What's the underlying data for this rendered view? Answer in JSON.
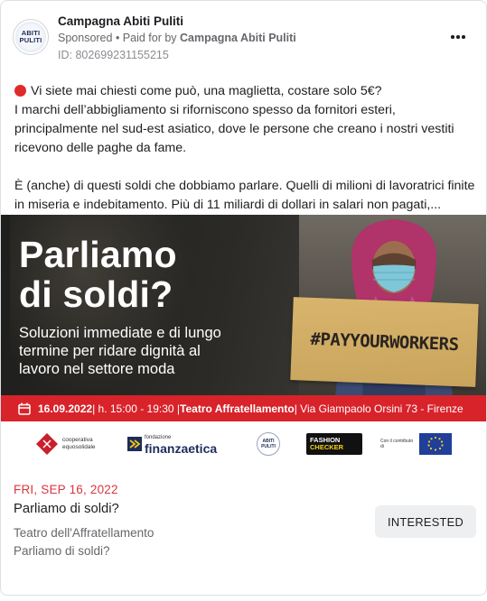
{
  "post": {
    "page_name": "Campagna Abiti Puliti",
    "sponsored_label": "Sponsored",
    "paid_for_prefix": " • Paid for by ",
    "paid_for_by": "Campagna Abiti Puliti",
    "ad_id": "ID: 802699231155215",
    "avatar_text_1": "ABITI",
    "avatar_text_2": "PULITI",
    "more_icon": "more-horizontal-icon"
  },
  "body": {
    "line1": "Vi siete mai chiesti come può, una maglietta, costare solo 5€?",
    "line2": "I marchi dell’abbigliamento si riforniscono spesso da fornitori esteri,",
    "line3": "principalmente nel sud-est asiatico, dove le persone che creano i nostri vestiti",
    "line4": "ricevono delle paghe da fame.",
    "line5": "È (anche) di questi soldi che dobbiamo parlare. Quelli di milioni di lavoratrici finite",
    "line6": "in miseria e indebitamento. Più di 11 miliardi di dollari in salari non pagati,..."
  },
  "creative": {
    "headline_1": "Parliamo",
    "headline_2": "di soldi?",
    "sub_1": "Soluzioni immediate e di lungo",
    "sub_2": "termine per ridare dignità al",
    "sub_3": "lavoro nel settore moda",
    "sign_text": "#PAYYOURWORKERS",
    "event_date": "16.09.2022",
    "event_time": " | h. 15:00 - 19:30 | ",
    "event_venue": "Teatro Affratellamento",
    "event_address": " | Via Giampaolo Orsini 73 - Firenze",
    "logo_1": "cooperativa equosolidale",
    "logo_2_small": "fondazione",
    "logo_2": "finanzaetica",
    "logo_3_a": "ABITI",
    "logo_3_b": "PULITI",
    "logo_4_a": "FASHION",
    "logo_4_b": "CHECKER",
    "logo_5_label": "Con il contributo di",
    "colors": {
      "event_bar": "#d8232a",
      "sign": "#d2ae66"
    }
  },
  "event": {
    "date": "FRI, SEP 16, 2022",
    "title": "Parliamo di soldi?",
    "venue": "Teatro dell'Affratellamento",
    "description": "Parliamo di soldi?",
    "interested_label": "INTERESTED"
  }
}
